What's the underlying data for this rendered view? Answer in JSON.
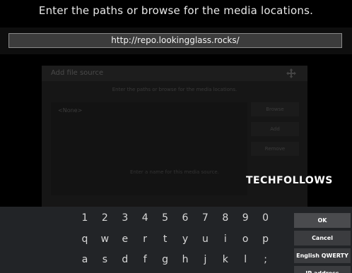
{
  "dialog": {
    "prompt": "Enter the paths or browse for the media locations.",
    "url_value": "http://repo.lookingglass.rocks/"
  },
  "background_dialog": {
    "title": "Add file source",
    "subtitle": "Enter the paths or browse for the media locations.",
    "list_item": "<None>",
    "browse_label": "Browse",
    "add_label": "Add",
    "remove_label": "Remove",
    "footer_text": "Enter a name for this media source."
  },
  "watermark": "TECHFOLLOWS",
  "keyboard": {
    "row_numbers": [
      "1",
      "2",
      "3",
      "4",
      "5",
      "6",
      "7",
      "8",
      "9",
      "0"
    ],
    "row_top": [
      "q",
      "w",
      "e",
      "r",
      "t",
      "y",
      "u",
      "i",
      "o",
      "p"
    ],
    "row_middle": [
      "a",
      "s",
      "d",
      "f",
      "g",
      "h",
      "j",
      "k",
      "l",
      ";"
    ],
    "ok_label": "OK",
    "cancel_label": "Cancel",
    "layout_label": "English QWERTY",
    "ip_label": "IP address"
  }
}
